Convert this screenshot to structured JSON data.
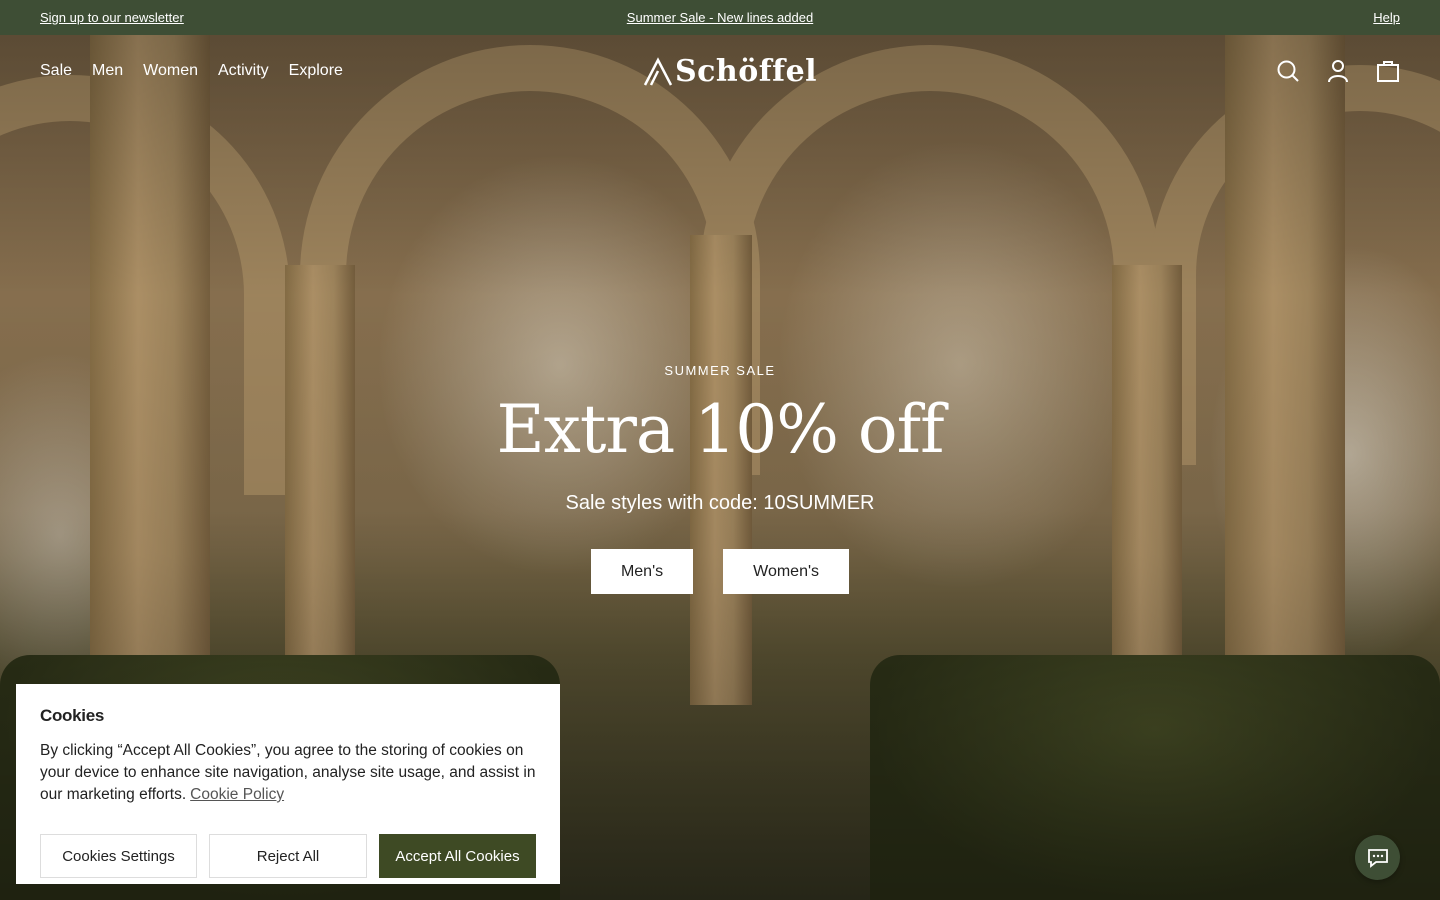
{
  "topbar": {
    "newsletter": "Sign up to our newsletter",
    "promo": "Summer Sale - New lines added",
    "help": "Help"
  },
  "nav": {
    "links": [
      "Sale",
      "Men",
      "Women",
      "Activity",
      "Explore"
    ],
    "logo": "Schöffel",
    "icons": [
      "search-icon",
      "account-icon",
      "bag-icon"
    ]
  },
  "hero": {
    "eyebrow": "SUMMER SALE",
    "headline": "Extra 10% off",
    "subline": "Sale styles with code: 10SUMMER",
    "ctas": [
      "Men's",
      "Women's"
    ]
  },
  "cookies": {
    "title": "Cookies",
    "body": "By clicking “Accept All Cookies”, you agree to the storing of cookies on your device to enhance site navigation, analyse site usage, and assist in our marketing efforts.",
    "policy_link": "Cookie Policy",
    "settings": "Cookies Settings",
    "reject": "Reject All",
    "accept": "Accept All Cookies"
  },
  "colors": {
    "brand_green": "#3e4e35",
    "accept_green": "#3e4a24"
  }
}
